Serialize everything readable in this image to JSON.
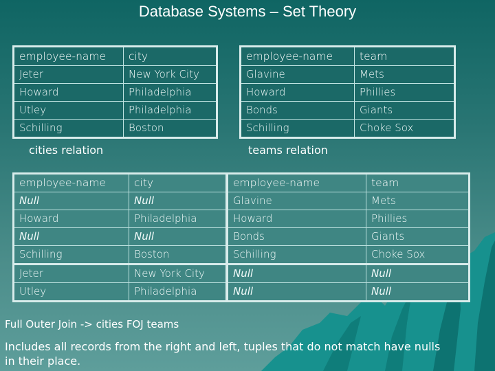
{
  "slide": {
    "title": "Database Systems – Set Theory"
  },
  "cities": {
    "caption": "cities relation",
    "headers": [
      "employee-name",
      "city"
    ],
    "rows": [
      [
        "Jeter",
        "New York City"
      ],
      [
        "Howard",
        "Philadelphia"
      ],
      [
        "Utley",
        "Philadelphia"
      ],
      [
        "Schilling",
        "Boston"
      ]
    ]
  },
  "teams": {
    "caption": "teams relation",
    "headers": [
      "employee-name",
      "team"
    ],
    "rows": [
      [
        "Glavine",
        "Mets"
      ],
      [
        "Howard",
        "Phillies"
      ],
      [
        "Bonds",
        "Giants"
      ],
      [
        "Schilling",
        "Choke Sox"
      ]
    ]
  },
  "foj": {
    "headers": [
      "employee-name",
      "city",
      "employee-name",
      "team"
    ],
    "rows": [
      [
        "Null",
        "Null",
        "Glavine",
        "Mets"
      ],
      [
        "Howard",
        "Philadelphia",
        "Howard",
        "Phillies"
      ],
      [
        "Null",
        "Null",
        "Bonds",
        "Giants"
      ],
      [
        "Schilling",
        "Boston",
        "Schilling",
        "Choke Sox"
      ],
      [
        "Jeter",
        "New York City",
        "Null",
        "Null"
      ],
      [
        "Utley",
        "Philadelphia",
        "Null",
        "Null"
      ]
    ]
  },
  "notes": {
    "line1": "Full Outer Join -> cities FOJ teams",
    "line2": "Includes all records from the right and left, tuples that do not match have nulls in their place."
  },
  "colors": {
    "background_top": "#0f6563",
    "background_bottom": "#5e9e9b",
    "table_border": "#d8eceb",
    "mountain": "#13908d"
  }
}
